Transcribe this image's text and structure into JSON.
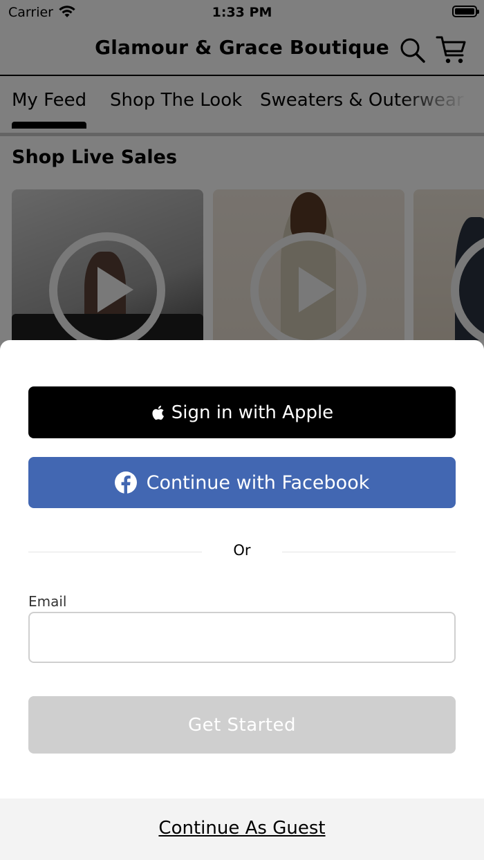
{
  "status_bar": {
    "carrier": "Carrier",
    "time": "1:33 PM"
  },
  "header": {
    "title": "Glamour & Grace Boutique"
  },
  "tabs": [
    {
      "label": "My Feed",
      "active": true
    },
    {
      "label": "Shop The Look",
      "active": false
    },
    {
      "label": "Sweaters & Outerwear",
      "active": false
    }
  ],
  "section": {
    "title": "Shop Live Sales"
  },
  "sheet": {
    "apple_label": "Sign in with Apple",
    "facebook_label": "Continue with Facebook",
    "or_label": "Or",
    "email_label": "Email",
    "email_value": "",
    "email_placeholder": "",
    "get_started_label": "Get Started",
    "guest_label": "Continue As Guest"
  },
  "colors": {
    "apple_button": "#000000",
    "facebook_button": "#4267b2",
    "disabled_button": "#cfcfcf",
    "guest_bar": "#f3f3f3",
    "overlay": "rgba(0,0,0,0.5)"
  }
}
